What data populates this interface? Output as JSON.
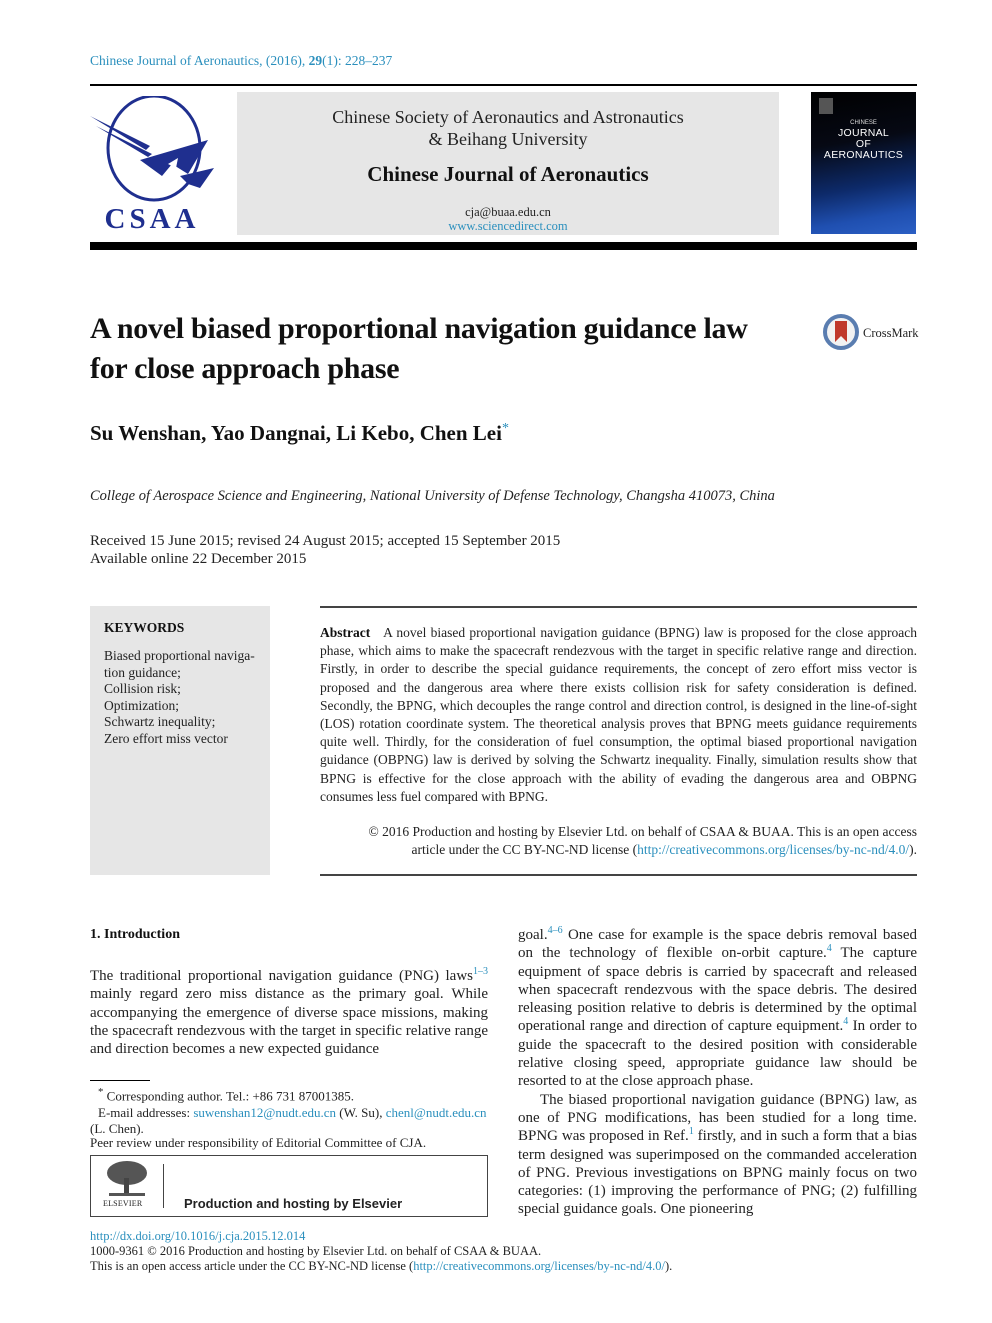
{
  "journal_ref": {
    "prefix": "Chinese Journal of Aeronautics, (2016), ",
    "volume": "29",
    "suffix": "(1): 228–237"
  },
  "header": {
    "logo_text": "CSAA",
    "society_line1": "Chinese Society of Aeronautics and Astronautics",
    "society_line2": "& Beihang University",
    "journal_name": "Chinese Journal of Aeronautics",
    "email": "cja@buaa.edu.cn",
    "website": "www.sciencedirect.com",
    "cover": {
      "line1": "CHINESE",
      "line2": "JOURNAL",
      "line3": "OF",
      "line4": "AERONAUTICS"
    }
  },
  "article": {
    "title": "A novel biased proportional navigation guidance law for close approach phase",
    "crossmark_label": "CrossMark",
    "authors": "Su Wenshan, Yao Dangnai, Li Kebo, Chen Lei",
    "corresponding_mark": "*",
    "affiliation": "College of Aerospace Science and Engineering, National University of Defense Technology, Changsha 410073, China",
    "received": "Received 15 June 2015; revised 24 August 2015; accepted 15 September 2015",
    "available": "Available online 22 December 2015"
  },
  "keywords": {
    "title": "KEYWORDS",
    "items": [
      "Biased proportional naviga-tion guidance;",
      "Collision risk;",
      "Optimization;",
      "Schwartz inequality;",
      "Zero effort miss vector"
    ]
  },
  "abstract": {
    "label": "Abstract",
    "text": "A novel biased proportional navigation guidance (BPNG) law is proposed for the close approach phase, which aims to make the spacecraft rendezvous with the target in specific relative range and direction. Firstly, in order to describe the special guidance requirements, the concept of zero effort miss vector is proposed and the dangerous area where there exists collision risk for safety consideration is defined. Secondly, the BPNG, which decouples the range control and direction control, is designed in the line-of-sight (LOS) rotation coordinate system. The theoretical analysis proves that BPNG meets guidance requirements quite well. Thirdly, for the consideration of fuel consumption, the optimal biased proportional navigation guidance (OBPNG) law is derived by solving the Schwartz inequality. Finally, simulation results show that BPNG is effective for the close approach with the ability of evading the dangerous area and OBPNG consumes less fuel compared with BPNG.",
    "copyright_line1": "© 2016 Production and hosting by Elsevier Ltd. on behalf of CSAA & BUAA. This is an open access",
    "copyright_line2": "article under the CC BY-NC-ND license (",
    "license_url": "http://creativecommons.org/licenses/by-nc-nd/4.0/",
    "copyright_end": ")."
  },
  "intro": {
    "heading": "1. Introduction",
    "left_p1_a": "The traditional proportional navigation guidance (PNG) laws",
    "left_ref1": "1–3",
    "left_p1_b": " mainly regard zero miss distance as the primary goal. While accompanying the emergence of diverse space missions, making the spacecraft rendezvous with the target in specific relative range and direction becomes a new expected guidance",
    "right_p1_a": "goal.",
    "right_ref1": "4–6",
    "right_p1_b": " One case for example is the space debris removal based on the technology of flexible on-orbit capture.",
    "right_ref2": "4",
    "right_p1_c": " The capture equipment of space debris is carried by spacecraft and released when spacecraft rendezvous with the space debris. The desired releasing position relative to debris is determined by the optimal operational range and direction of capture equipment.",
    "right_ref3": "4",
    "right_p1_d": " In order to guide the spacecraft to the desired position with considerable relative closing speed, appropriate guidance law should be resorted to at the close approach phase.",
    "right_p2_a": "The biased proportional navigation guidance (BPNG) law, as one of PNG modifications, has been studied for a long time. BPNG was proposed in Ref.",
    "right_ref4": "1",
    "right_p2_b": " firstly, and in such a form that a bias term designed was superimposed on the commanded acceleration of PNG. Previous investigations on BPNG mainly focus on two categories: (1) improving the performance of PNG; (2) fulfilling special guidance goals. One pioneering"
  },
  "footnotes": {
    "mark": "*",
    "corresponding": " Corresponding author. Tel.: +86 731 87001385.",
    "email_prefix": "E-mail addresses: ",
    "email1": "suwenshan12@nudt.edu.cn",
    "email1_name": " (W. Su), ",
    "email2": "chenl@nudt.edu.cn",
    "email2_name": " (L. Chen).",
    "peer_review": "Peer review under responsibility of Editorial Committee of CJA.",
    "elsevier_word": "ELSEVIER",
    "elsevier_text": "Production and hosting by Elsevier"
  },
  "bottom": {
    "doi": "http://dx.doi.org/10.1016/j.cja.2015.12.014",
    "issn_line": "1000-9361 © 2016 Production and hosting by Elsevier Ltd. on behalf of CSAA & BUAA.",
    "license_prefix": "This is an open access article under the CC BY-NC-ND license (",
    "license_url": "http://creativecommons.org/licenses/by-nc-nd/4.0/",
    "license_suffix": ")."
  },
  "colors": {
    "link": "#2a8fbd",
    "logo_blue": "#1f2f8f",
    "header_gray": "#e6e6e6"
  }
}
